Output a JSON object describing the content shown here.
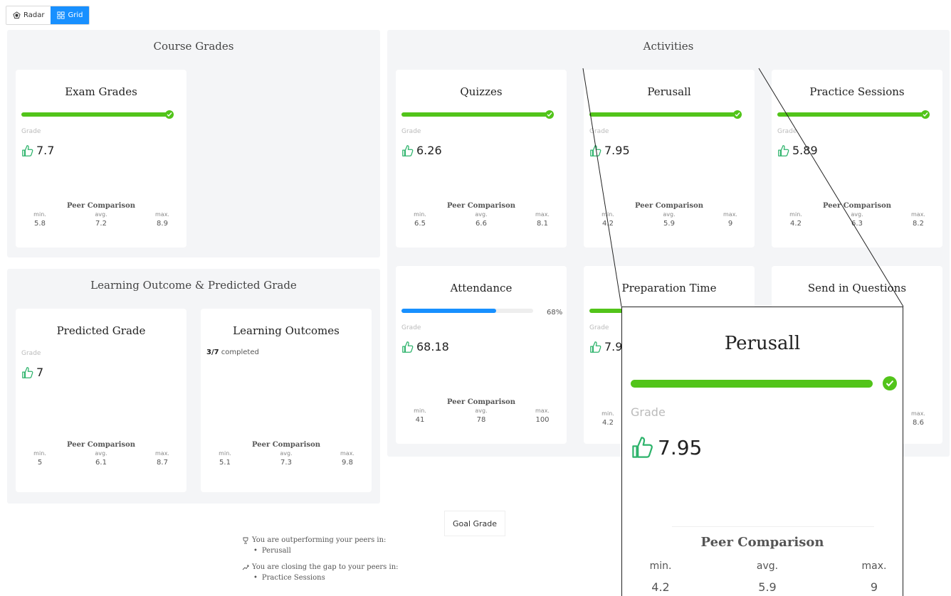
{
  "toggle": {
    "radar_label": "Radar",
    "grid_label": "Grid"
  },
  "colors": {
    "green": "#52c41a",
    "blue": "#1890ff",
    "thumb": "#2db36b"
  },
  "sections": {
    "course": {
      "title": "Course Grades"
    },
    "activities": {
      "title": "Activities"
    },
    "learning": {
      "title": "Learning Outcome & Predicted Grade"
    }
  },
  "peer_title": "Peer Comparison",
  "labels": {
    "grade": "Grade",
    "min": "min.",
    "avg": "avg.",
    "max": "max."
  },
  "cards": {
    "exam": {
      "title": "Exam Grades",
      "progress": 1.0,
      "grade": "7.7",
      "min": "5.8",
      "avg": "7.2",
      "max": "8.9"
    },
    "quizzes": {
      "title": "Quizzes",
      "progress": 1.0,
      "grade": "6.26",
      "min": "6.5",
      "avg": "6.6",
      "max": "8.1"
    },
    "perusall": {
      "title": "Perusall",
      "progress": 1.0,
      "grade": "7.95",
      "min": "4.2",
      "avg": "5.9",
      "max": "9"
    },
    "practice": {
      "title": "Practice Sessions",
      "progress": 1.0,
      "grade": "5.89",
      "min": "4.2",
      "avg": "6.3",
      "max": "8.2"
    },
    "attendance": {
      "title": "Attendance",
      "progress_label": "68%",
      "progress": 0.68,
      "grade": "68.18",
      "min": "41",
      "avg": "78",
      "max": "100"
    },
    "prep": {
      "title": "Preparation Time",
      "grade": "7.9",
      "min": "4.2"
    },
    "questions": {
      "title": "Send in Questions",
      "max": "8.6"
    },
    "predicted": {
      "title": "Predicted Grade",
      "grade": "7",
      "min": "5",
      "avg": "6.1",
      "max": "8.7"
    },
    "outcomes": {
      "title": "Learning Outcomes",
      "completed_count": "3/7",
      "completed_text": " completed",
      "min": "5.1",
      "avg": "7.3",
      "max": "9.8"
    }
  },
  "goal_button": "Goal Grade",
  "insights": {
    "outperform": "You are outperforming your peers in:",
    "outperform_items": [
      "Perusall"
    ],
    "closing": "You are closing the gap to your peers in:",
    "closing_items": [
      "Practice Sessions"
    ]
  },
  "zoom": {
    "title": "Perusall",
    "grade_label": "Grade",
    "grade": "7.95",
    "peer_title": "Peer Comparison",
    "min_label": "min.",
    "avg_label": "avg.",
    "max_label": "max.",
    "min": "4.2",
    "avg": "5.9",
    "max": "9"
  }
}
